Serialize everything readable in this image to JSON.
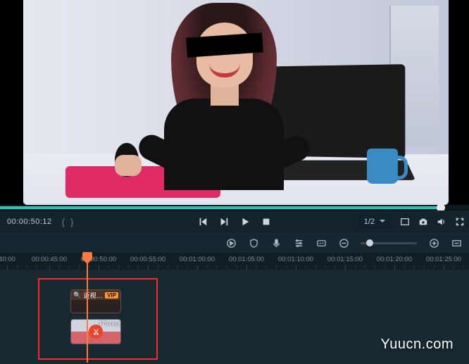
{
  "transport": {
    "timecode": "00:00:50:12",
    "brace_open": "{",
    "brace_close": "}",
    "ratio": "1/2"
  },
  "ruler": {
    "ticks": [
      {
        "label": "40:00",
        "pos": 10
      },
      {
        "label": "00:00:45:00",
        "pos": 70
      },
      {
        "label": "00:00:50:00",
        "pos": 140
      },
      {
        "label": "00:00:55:00",
        "pos": 210
      },
      {
        "label": "00:01:00:00",
        "pos": 280
      },
      {
        "label": "00:01:05:00",
        "pos": 350
      },
      {
        "label": "00:01:10:00",
        "pos": 420
      },
      {
        "label": "00:01:15:00",
        "pos": 490
      },
      {
        "label": "00:01:20:00",
        "pos": 560
      },
      {
        "label": "00:01:25:00",
        "pos": 630
      }
    ]
  },
  "clips": {
    "effect": {
      "label": "近视…",
      "badge": "VIP"
    },
    "video": {
      "label": "176.png"
    }
  },
  "watermark": "Yuucn.com",
  "icons": {
    "prev": "prev-icon",
    "step": "step-icon",
    "play": "play-icon",
    "stop": "stop-icon",
    "chevron": "chevron-down-icon",
    "screen": "safe-area-icon",
    "snapshot": "camera-icon",
    "volume": "volume-icon",
    "fullscreen": "fullscreen-icon",
    "timer": "timer-icon",
    "shield": "shield-icon",
    "mic": "mic-icon",
    "list": "properties-icon",
    "cc": "caption-icon",
    "minus": "zoom-out-icon",
    "plus": "zoom-in-icon",
    "fit": "fit-icon"
  }
}
